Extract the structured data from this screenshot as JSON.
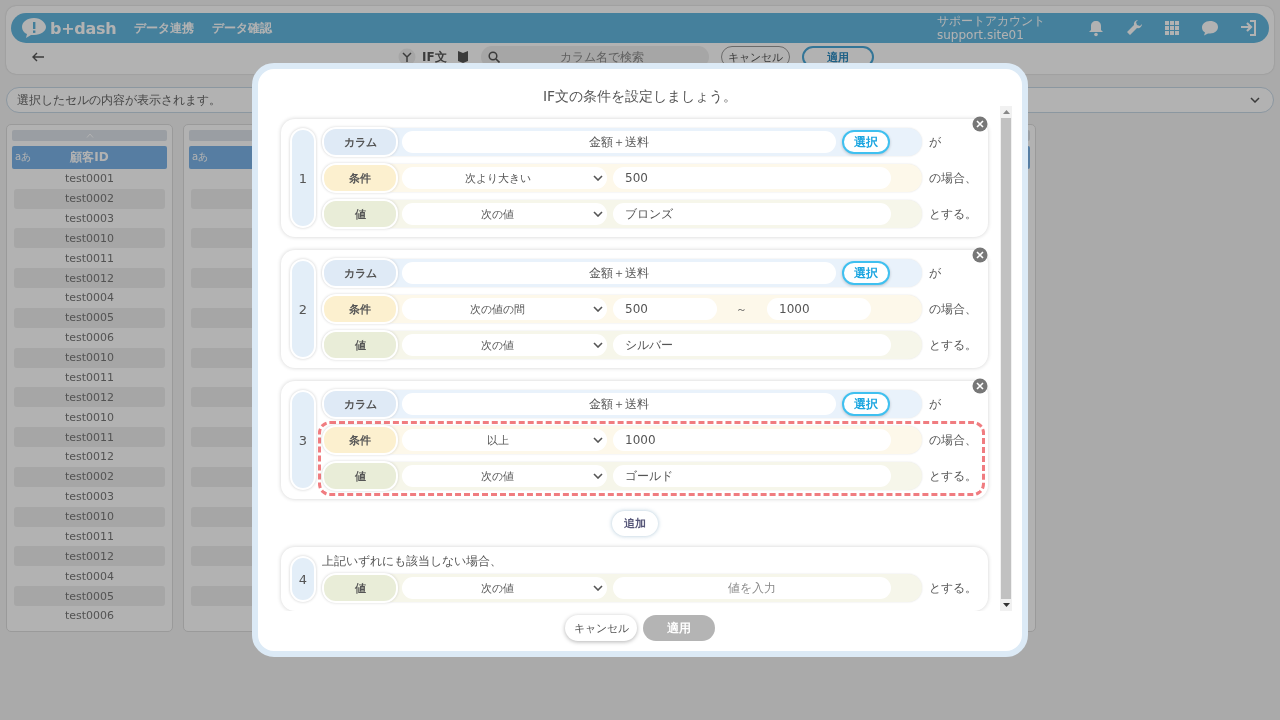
{
  "header": {
    "logo": "b+dash",
    "nav": [
      "データ連携",
      "データ確認"
    ],
    "account_name": "サポートアカウント",
    "account_id": "support.site01"
  },
  "toolbar": {
    "label": "IF文",
    "search": {
      "placeholder": "カラム名で検索"
    },
    "buttons": [
      {
        "label": "キャンセル",
        "kind": "outline"
      },
      {
        "label": "適用",
        "kind": "primary"
      }
    ]
  },
  "cell_preview": {
    "placeholder": "選択したセルの内容が表示されます。"
  },
  "table": {
    "columns": [
      {
        "type_badge": "aあ",
        "header": "顧客ID",
        "cells": [
          "test0001",
          "test0002",
          "test0003",
          "test0010",
          "test0011",
          "test0012",
          "test0004",
          "test0005",
          "test0006",
          "test0010",
          "test0011",
          "test0012",
          "test0010",
          "test0011",
          "test0012",
          "test0002",
          "test0003",
          "test0010",
          "test0011",
          "test0012",
          "test0004",
          "test0005",
          "test0006"
        ]
      },
      {
        "type_badge": "aあ"
      }
    ]
  },
  "dialog": {
    "title": "IF文の条件を設定しましょう。",
    "conditions": [
      {
        "number": "1",
        "rows": [
          {
            "kind": "column",
            "label": "カラム",
            "value": "金額＋送料",
            "button": "選択",
            "suffix": "が",
            "highlighted": false
          },
          {
            "kind": "condition",
            "label": "条件",
            "operator": "次より大きい",
            "values": [
              "500"
            ],
            "suffix": "の場合、",
            "highlighted": false
          },
          {
            "kind": "value",
            "label": "値",
            "mode": "次の値",
            "value": "ブロンズ",
            "suffix": "とする。",
            "highlighted": false
          }
        ]
      },
      {
        "number": "2",
        "rows": [
          {
            "kind": "column",
            "label": "カラム",
            "value": "金額＋送料",
            "button": "選択",
            "suffix": "が",
            "highlighted": false
          },
          {
            "kind": "condition",
            "label": "条件",
            "operator": "次の値の間",
            "values": [
              "500",
              "1000"
            ],
            "separator": "～",
            "suffix": "の場合、",
            "highlighted": false
          },
          {
            "kind": "value",
            "label": "値",
            "mode": "次の値",
            "value": "シルバー",
            "suffix": "とする。",
            "highlighted": false
          }
        ]
      },
      {
        "number": "3",
        "rows": [
          {
            "kind": "column",
            "label": "カラム",
            "value": "金額＋送料",
            "button": "選択",
            "suffix": "が",
            "highlighted": false
          },
          {
            "kind": "condition",
            "label": "条件",
            "operator": "以上",
            "values": [
              "1000"
            ],
            "suffix": "の場合、",
            "highlighted": true
          },
          {
            "kind": "value",
            "label": "値",
            "mode": "次の値",
            "value": "ゴールド",
            "suffix": "とする。",
            "highlighted": true
          }
        ]
      }
    ],
    "add_button": "追加",
    "else": {
      "number": "4",
      "caption": "上記いずれにも該当しない場合、",
      "rows": [
        {
          "kind": "value",
          "label": "値",
          "mode": "次の値",
          "placeholder": "値を入力",
          "suffix": "とする。",
          "highlighted": false
        }
      ]
    },
    "buttons": [
      {
        "label": "キャンセル",
        "disabled": false
      },
      {
        "label": "適用",
        "disabled": true
      }
    ]
  }
}
